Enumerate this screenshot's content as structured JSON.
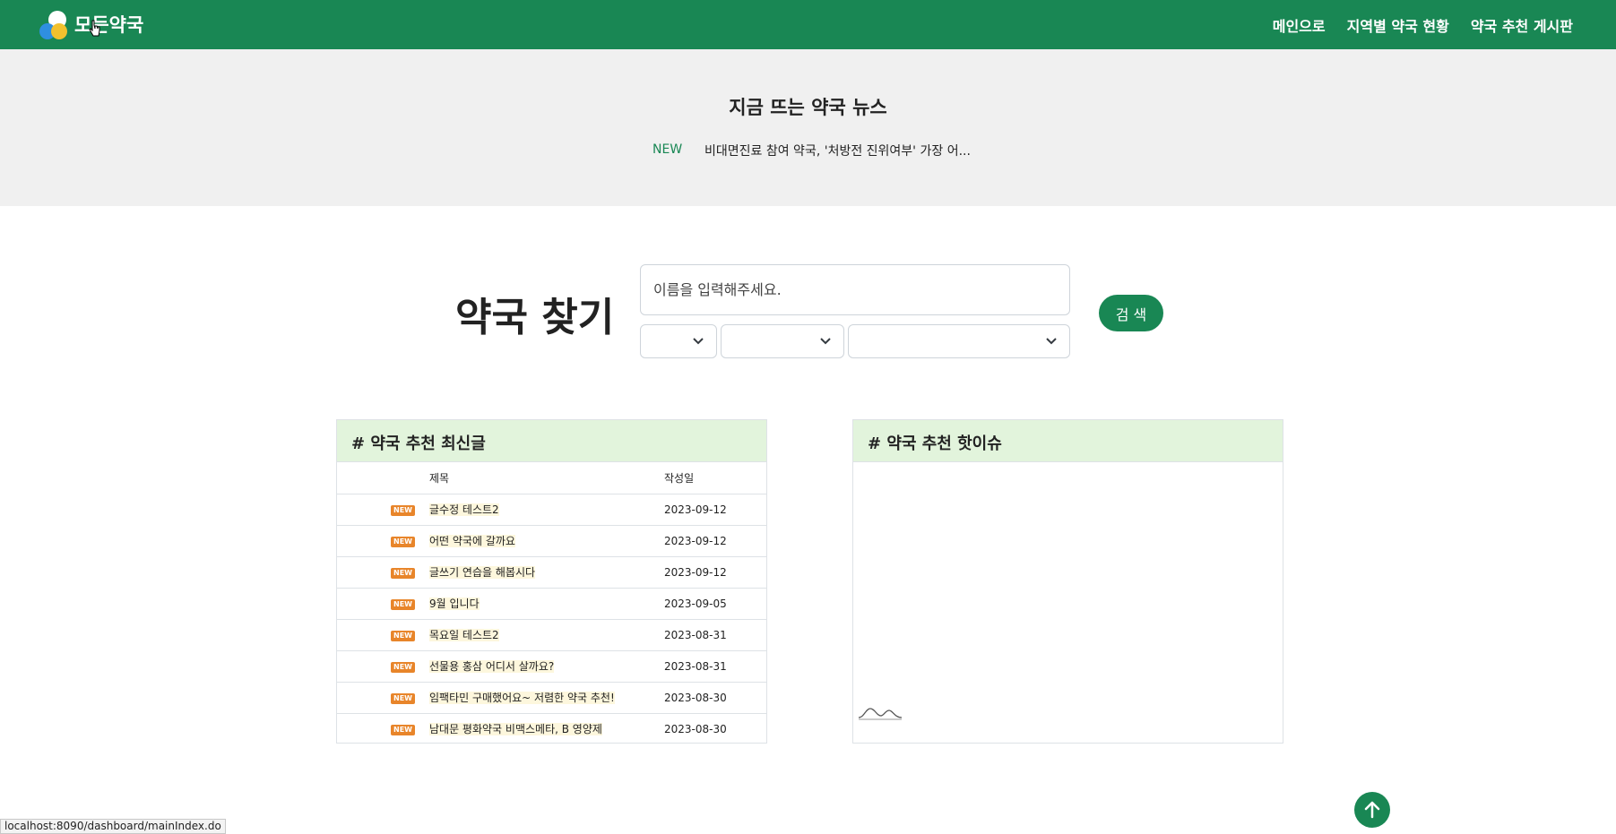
{
  "header": {
    "brand": "모든약국",
    "nav": [
      "메인으로",
      "지역별 약국 현황",
      "약국 추천 게시판"
    ]
  },
  "news": {
    "title": "지금 뜨는 약국 뉴스",
    "badge": "NEW",
    "headline": "비대면진료 참여 약국, '처방전 진위여부' 가장 어..."
  },
  "search": {
    "title": "약국 찾기",
    "placeholder": "이름을 입력해주세요.",
    "button": "검 색",
    "selects": [
      "",
      "",
      ""
    ]
  },
  "latest": {
    "heading": "# 약국 추천 최신글",
    "columns": [
      "제목",
      "작성일"
    ],
    "rows": [
      {
        "badge": "NEW",
        "title": "글수정 테스트2",
        "date": "2023-09-12"
      },
      {
        "badge": "NEW",
        "title": "어떤 약국에 갈까요",
        "date": "2023-09-12"
      },
      {
        "badge": "NEW",
        "title": "글쓰기 연습을 해봅시다",
        "date": "2023-09-12"
      },
      {
        "badge": "NEW",
        "title": "9월 입니다",
        "date": "2023-09-05"
      },
      {
        "badge": "NEW",
        "title": "목요일 테스트2",
        "date": "2023-08-31"
      },
      {
        "badge": "NEW",
        "title": "선물용 홍삼 어디서 살까요?",
        "date": "2023-08-31"
      },
      {
        "badge": "NEW",
        "title": "임팩타민 구매했어요~ 저렴한 약국 추천!",
        "date": "2023-08-30"
      },
      {
        "badge": "NEW",
        "title": "남대문 평화약국 비맥스메타, B 영양제",
        "date": "2023-08-30"
      }
    ]
  },
  "hot": {
    "heading": "# 약국 추천 핫이슈"
  },
  "statusbar": "localhost:8090/dashboard/mainIndex.do",
  "colors": {
    "primary": "#198754",
    "panel_head": "#e2f4dc",
    "news_bg": "#f0f0f0",
    "badge": "#e8852a"
  }
}
